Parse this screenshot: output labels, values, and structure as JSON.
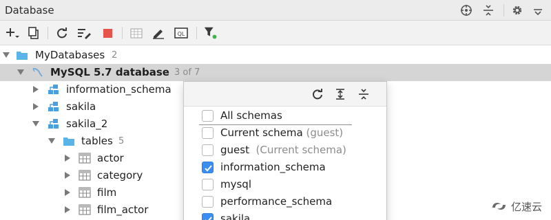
{
  "header": {
    "title": "Database",
    "icons": [
      "crosshair-icon",
      "collapse-icon",
      "gear-icon",
      "hide-icon"
    ]
  },
  "toolbar": {
    "buttons": [
      "add-icon",
      "copy-icon",
      "refresh-icon",
      "properties-icon",
      "stop-icon",
      "table-editor-icon",
      "edit-icon",
      "query-console-icon",
      "filter-icon"
    ]
  },
  "tree": {
    "root": {
      "label": "MyDatabases",
      "count": "2"
    },
    "datasource": {
      "label": "MySQL 5.7 database",
      "count": "3 of 7"
    },
    "schemas": [
      {
        "label": "information_schema"
      },
      {
        "label": "sakila"
      },
      {
        "label": "sakila_2"
      }
    ],
    "tables_folder": {
      "label": "tables",
      "count": "5"
    },
    "tables": [
      "actor",
      "category",
      "film",
      "film_actor"
    ]
  },
  "popup": {
    "toolbar_icons": [
      "refresh-icon",
      "expand-all-icon",
      "collapse-all-icon"
    ],
    "options": [
      {
        "label": "All schemas",
        "hint": "",
        "checked": false
      },
      {
        "label": "Current schema",
        "hint": "(guest)",
        "checked": false
      },
      {
        "label": "guest",
        "hint": "(Current schema)",
        "checked": false
      },
      {
        "label": "information_schema",
        "hint": "",
        "checked": true
      },
      {
        "label": "mysql",
        "hint": "",
        "checked": false
      },
      {
        "label": "performance_schema",
        "hint": "",
        "checked": false
      },
      {
        "label": "sakila",
        "hint": "",
        "checked": true
      }
    ]
  },
  "watermark": {
    "text": "亿速云"
  },
  "colors": {
    "folder": "#5ab4e8",
    "selection": "#d5d5d5",
    "checkbox_checked": "#3b8ef0",
    "stop": "#e5534b",
    "filter_dot": "#3cb54a"
  }
}
